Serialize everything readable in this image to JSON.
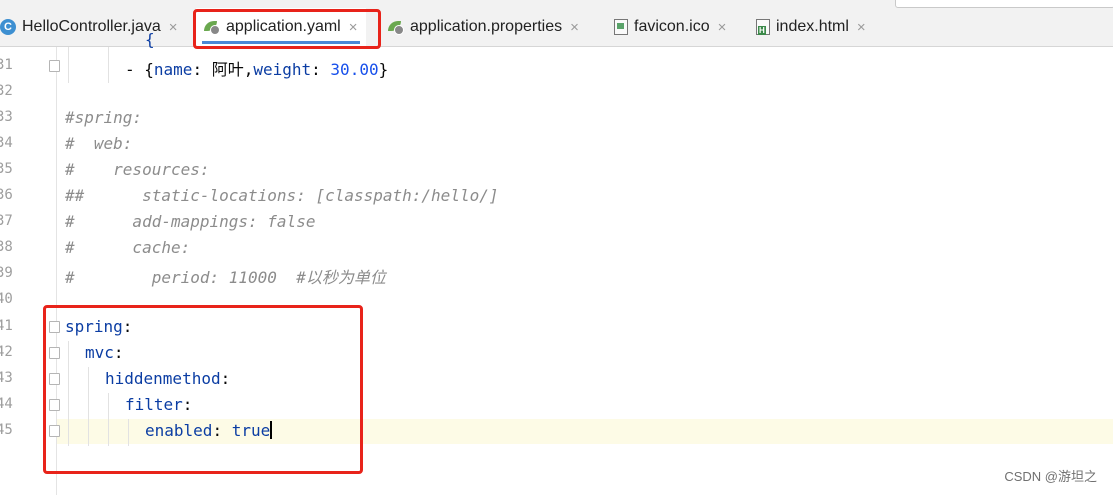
{
  "tabs": [
    {
      "label": "HelloController.java",
      "icon": "java-class-icon",
      "active": false
    },
    {
      "label": "application.yaml",
      "icon": "spring-config-icon",
      "active": true
    },
    {
      "label": "application.properties",
      "icon": "spring-config-icon",
      "active": false
    },
    {
      "label": "favicon.ico",
      "icon": "image-file-icon",
      "active": false
    },
    {
      "label": "index.html",
      "icon": "html-file-icon",
      "active": false
    }
  ],
  "close_glyph": "×",
  "line_numbers": [
    "31",
    "32",
    "33",
    "34",
    "35",
    "36",
    "37",
    "38",
    "39",
    "40",
    "41",
    "42",
    "43",
    "44",
    "45"
  ],
  "code": {
    "l31": {
      "dash": "- {",
      "k1": "name",
      "c1": ": ",
      "v1": "阿叶",
      "comma": ",",
      "k2": "weight",
      "c2": ": ",
      "v2": "30.00",
      "end": "}"
    },
    "l33": "#spring:",
    "l34": "#  web:",
    "l35": "#    resources:",
    "l36": "##      static-locations: [classpath:/hello/]",
    "l37": "#      add-mappings: false",
    "l38": "#      cache:",
    "l39": "#        period: 11000  #以秒为单位",
    "l41": {
      "key": "spring",
      "colon": ":"
    },
    "l42": {
      "key": "mvc",
      "colon": ":"
    },
    "l43": {
      "key": "hiddenmethod",
      "colon": ":"
    },
    "l44": {
      "key": "filter",
      "colon": ":"
    },
    "l45": {
      "key": "enabled",
      "colon": ": ",
      "value": "true"
    }
  },
  "watermark": "CSDN @游坦之",
  "colors": {
    "highlight_box": "#e8231a",
    "active_tab_underline": "#4a88d6"
  }
}
